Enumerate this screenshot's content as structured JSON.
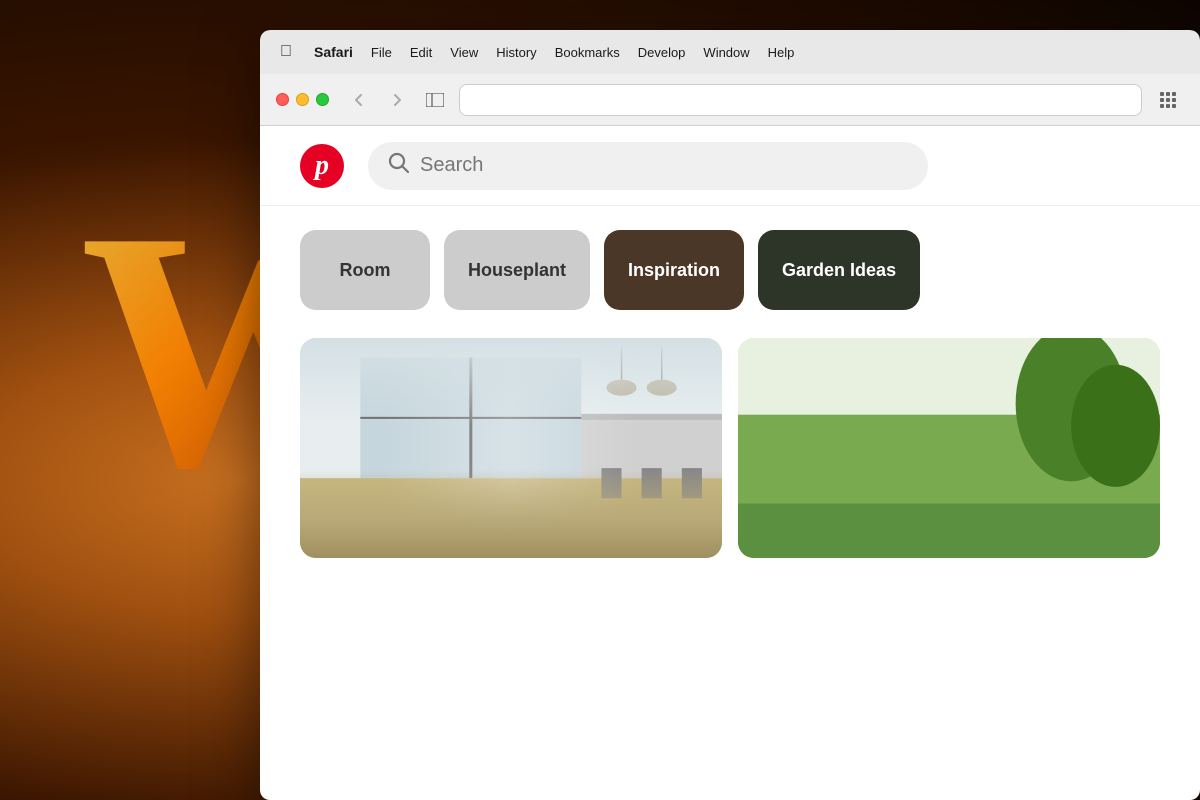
{
  "background": {
    "letter": "W"
  },
  "menubar": {
    "apple_symbol": "",
    "app_name": "Safari",
    "items": [
      "File",
      "Edit",
      "View",
      "History",
      "Bookmarks",
      "Develop",
      "Window",
      "Help"
    ]
  },
  "toolbar": {
    "back_icon": "‹",
    "forward_icon": "›",
    "sidebar_icon": "⬜",
    "grid_icon": "⠿"
  },
  "pinterest": {
    "logo_letter": "p",
    "search_placeholder": "Search",
    "categories": [
      {
        "label": "Room",
        "style": "light"
      },
      {
        "label": "Houseplant",
        "style": "light"
      },
      {
        "label": "Inspiration",
        "style": "dark-brown"
      },
      {
        "label": "Garden Ideas",
        "style": "darkest"
      }
    ]
  }
}
